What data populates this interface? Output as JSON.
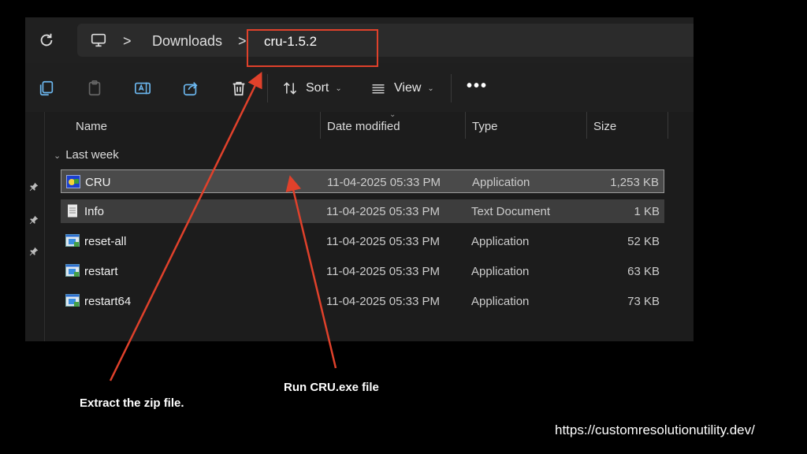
{
  "address_bar": {
    "breadcrumbs": [
      "Downloads",
      "cru-1.5.2"
    ],
    "separator": ">"
  },
  "toolbar": {
    "sort_label": "Sort",
    "view_label": "View",
    "more_label": "•••"
  },
  "columns": [
    "Name",
    "Date modified",
    "Type",
    "Size"
  ],
  "group_label": "Last week",
  "files": [
    {
      "name": "CRU",
      "date": "11-04-2025 05:33 PM",
      "type": "Application",
      "size": "1,253 KB",
      "icon": "cru-app-icon",
      "state": "selected"
    },
    {
      "name": "Info",
      "date": "11-04-2025 05:33 PM",
      "type": "Text Document",
      "size": "1 KB",
      "icon": "text-document-icon",
      "state": "hover"
    },
    {
      "name": "reset-all",
      "date": "11-04-2025 05:33 PM",
      "type": "Application",
      "size": "52 KB",
      "icon": "application-icon",
      "state": "normal"
    },
    {
      "name": "restart",
      "date": "11-04-2025 05:33 PM",
      "type": "Application",
      "size": "63 KB",
      "icon": "application-icon",
      "state": "normal"
    },
    {
      "name": "restart64",
      "date": "11-04-2025 05:33 PM",
      "type": "Application",
      "size": "73 KB",
      "icon": "application-icon",
      "state": "normal"
    }
  ],
  "annotations": {
    "extract_caption": "Extract the zip file.",
    "run_caption": "Run CRU.exe file",
    "accent_color": "#e0412b"
  },
  "footer_url": "https://customresolutionutility.dev/"
}
